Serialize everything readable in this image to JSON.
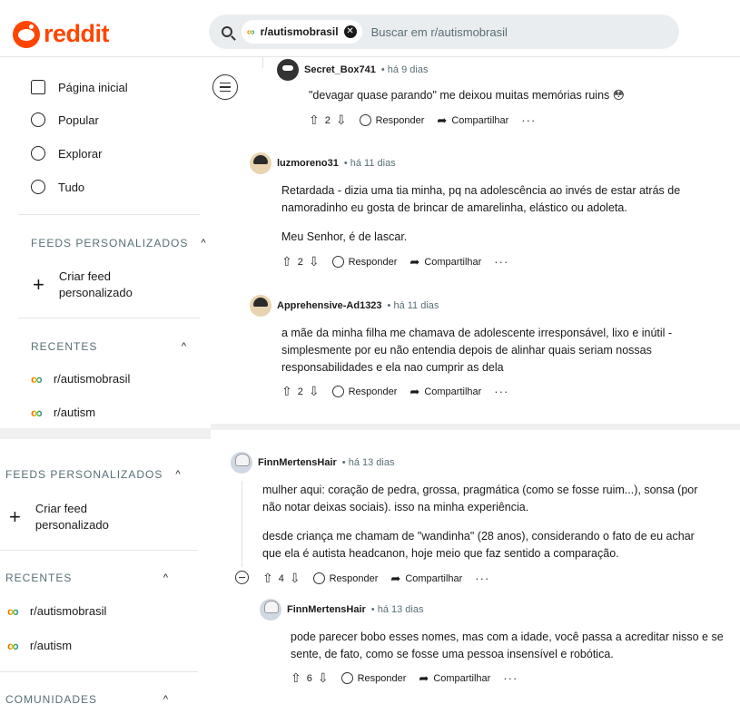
{
  "header": {
    "logo_text": "reddit",
    "search_chip": "r/autismobrasil",
    "search_placeholder": "Buscar em r/autismobrasil"
  },
  "sidebar_top": {
    "nav": [
      {
        "label": "Página inicial",
        "icon": "home-icon"
      },
      {
        "label": "Popular",
        "icon": "popular-icon"
      },
      {
        "label": "Explorar",
        "icon": "explore-icon"
      },
      {
        "label": "Tudo",
        "icon": "all-icon"
      }
    ],
    "feeds_title": "FEEDS PERSONALIZADOS",
    "create_feed": "Criar feed\npersonalizado",
    "recent_title": "RECENTES",
    "recent": [
      "r/autismobrasil",
      "r/autism"
    ]
  },
  "sidebar_bottom": {
    "feeds_title": "FEEDS PERSONALIZADOS",
    "create_feed": "Criar feed\npersonalizado",
    "recent_title": "RECENTES",
    "recent": [
      "r/autismobrasil",
      "r/autism"
    ],
    "communities_title": "COMUNIDADES"
  },
  "actions": {
    "reply": "Responder",
    "share": "Compartilhar",
    "more": "···"
  },
  "comments": [
    {
      "user": "Secret_Box741",
      "time": "• há 9 dias",
      "body": "\"devagar quase parando\" me deixou muitas memórias ruins 😳",
      "votes": "2"
    },
    {
      "user": "luzmoreno31",
      "time": "• há 11 dias",
      "body": "Retardada - dizia uma tia minha, pq na adolescência ao invés de estar atrás de namoradinho eu gosta de brincar de amarelinha, elástico ou adoleta.",
      "body2": "Meu Senhor, é de lascar.",
      "votes": "2"
    },
    {
      "user": "Apprehensive-Ad1323",
      "time": "• há 11 dias",
      "body": "a mãe da minha filha me chamava de adolescente irresponsável, lixo e inútil - simplesmente por eu não entendia depois de alinhar quais seriam nossas responsabilidades e ela nao cumprir as dela",
      "votes": "2"
    },
    {
      "user": "FinnMertensHair",
      "time": "• há 13 dias",
      "body": "mulher aqui: coração de pedra, grossa, pragmática (como se fosse ruim...), sonsa (por não notar deixas sociais). isso na minha experiência.",
      "body2": "desde criança me chamam de \"wandinha\" (28 anos), considerando o fato de eu achar que ela é autista headcanon, hoje meio que faz sentido a comparação.",
      "votes": "4"
    },
    {
      "user": "FinnMertensHair",
      "time": "• há 13 dias",
      "body": "pode parecer bobo esses nomes, mas com a idade, você passa a acreditar nisso e se sente, de fato, como se fosse uma pessoa insensível e robótica.",
      "votes": "6"
    }
  ]
}
